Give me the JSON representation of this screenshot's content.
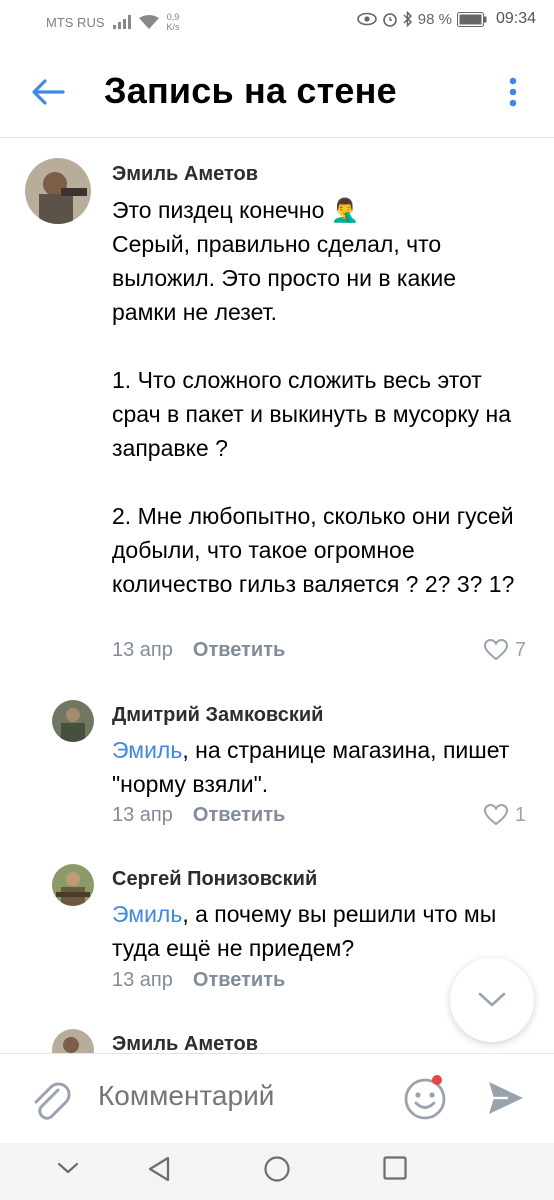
{
  "status_bar": {
    "carrier": "MTS RUS",
    "speed_value": "0,9",
    "speed_unit": "K/s",
    "battery": "98 %",
    "time": "09:34"
  },
  "header": {
    "title": "Запись на стене"
  },
  "comments": [
    {
      "author": "Эмиль Аметов",
      "text": "Это пиздец конечно 🤦‍♂️\nСерый, правильно сделал, что выложил. Это просто ни в какие рамки не лезет.\n\n1. Что сложного сложить весь этот срач в пакет и выкинуть в мусорку на заправке ?\n\n2. Мне любопытно, сколько они гусей добыли, что такое огромное количество гильз валяется ? 2? 3? 1?",
      "date": "13 апр",
      "reply_label": "Ответить",
      "likes": "7"
    },
    {
      "author": "Дмитрий Замковский",
      "mention": "Эмиль",
      "text": ", на странице магазина, пишет \"норму взяли\".",
      "date": "13 апр",
      "reply_label": "Ответить",
      "likes": "1"
    },
    {
      "author": "Сергей Понизовский",
      "mention": "Эмиль",
      "text": ", а почему вы решили что мы туда ещё не приедем?",
      "date": "13 апр",
      "reply_label": "Ответить"
    },
    {
      "author": "Эмиль Аметов"
    }
  ],
  "composer": {
    "placeholder": "Комментарий"
  },
  "colors": {
    "accent": "#3f8ae0",
    "secondary_text": "#818c99",
    "notification_dot": "#e64646"
  }
}
